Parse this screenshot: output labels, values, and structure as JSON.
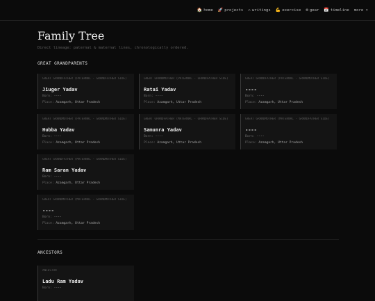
{
  "nav": [
    {
      "icon": "🏠",
      "label": "home"
    },
    {
      "icon": "🚀",
      "label": "projects"
    },
    {
      "icon": "✍",
      "label": "writings"
    },
    {
      "icon": "💪",
      "label": "exercise"
    },
    {
      "icon": "⚙",
      "label": "gear"
    },
    {
      "icon": "📅",
      "label": "timeline"
    },
    {
      "icon": "",
      "label": "more ▾"
    }
  ],
  "page": {
    "title": "Family Tree",
    "subtitle": "Direct lineage: paternal & maternal lines, chronologically ordered."
  },
  "sections": {
    "great_grandparents": "GREAT GRANDPARENTS",
    "ancestors": "ANCESTORS"
  },
  "great_grandparents": [
    {
      "role": "GREAT GRANDFATHER (PATERNAL - GRANDFATHER SIDE)",
      "name": "Jiuger Yadav",
      "born_label": "Born:",
      "born": "----",
      "place_label": "Place:",
      "place": "Azamgarh, Uttar Pradesh"
    },
    {
      "role": "GREAT GRANDMOTHER (PATERNAL - GRANDFATHER SIDE)",
      "name": "Ratai Yadav",
      "born_label": "Born:",
      "born": "----",
      "place_label": "Place:",
      "place": "Azamgarh, Uttar Pradesh"
    },
    {
      "role": "GREAT GRANDFATHER (PATERNAL - GRANDMOTHER SIDE)",
      "name": "----",
      "born_label": "Born:",
      "born": "----",
      "place_label": "Place:",
      "place": "Azamgarh, Uttar Pradesh"
    },
    {
      "role": "GREAT GRANDMOTHER (PATERNAL - GRANDMOTHER SIDE)",
      "name": "Hubba Yadav",
      "born_label": "Born:",
      "born": "----",
      "place_label": "Place:",
      "place": "Azamgarh, Uttar Pradesh"
    },
    {
      "role": "GREAT GRANDFATHER (MATERNAL - GRANDFATHER SIDE)",
      "name": "Samunra Yadav",
      "born_label": "Born:",
      "born": "----",
      "place_label": "Place:",
      "place": "Azamgarh, Uttar Pradesh"
    },
    {
      "role": "GREAT GRANDMOTHER (MATERNAL - GRANDFATHER SIDE)",
      "name": "----",
      "born_label": "Born:",
      "born": "----",
      "place_label": "Place:",
      "place": "Azamgarh, Uttar Pradesh"
    },
    {
      "role": "GREAT GRANDFATHER (MATERNAL - GRANDMOTHER SIDE)",
      "name": "Ram Saran Yadav",
      "born_label": "Born:",
      "born": "----",
      "place_label": "Place:",
      "place": "Azamgarh, Uttar Pradesh"
    },
    {
      "role": "GREAT GRANDMOTHER (MATERNAL - GRANDMOTHER SIDE)",
      "name": "----",
      "born_label": "Born:",
      "born": "----",
      "place_label": "Place:",
      "place": "Azamgarh, Uttar Pradesh"
    }
  ],
  "ancestors": [
    {
      "role": "ANCESTOR",
      "name": "Ladu Ram Yadav",
      "born_label": "Born:",
      "born": "----"
    }
  ]
}
